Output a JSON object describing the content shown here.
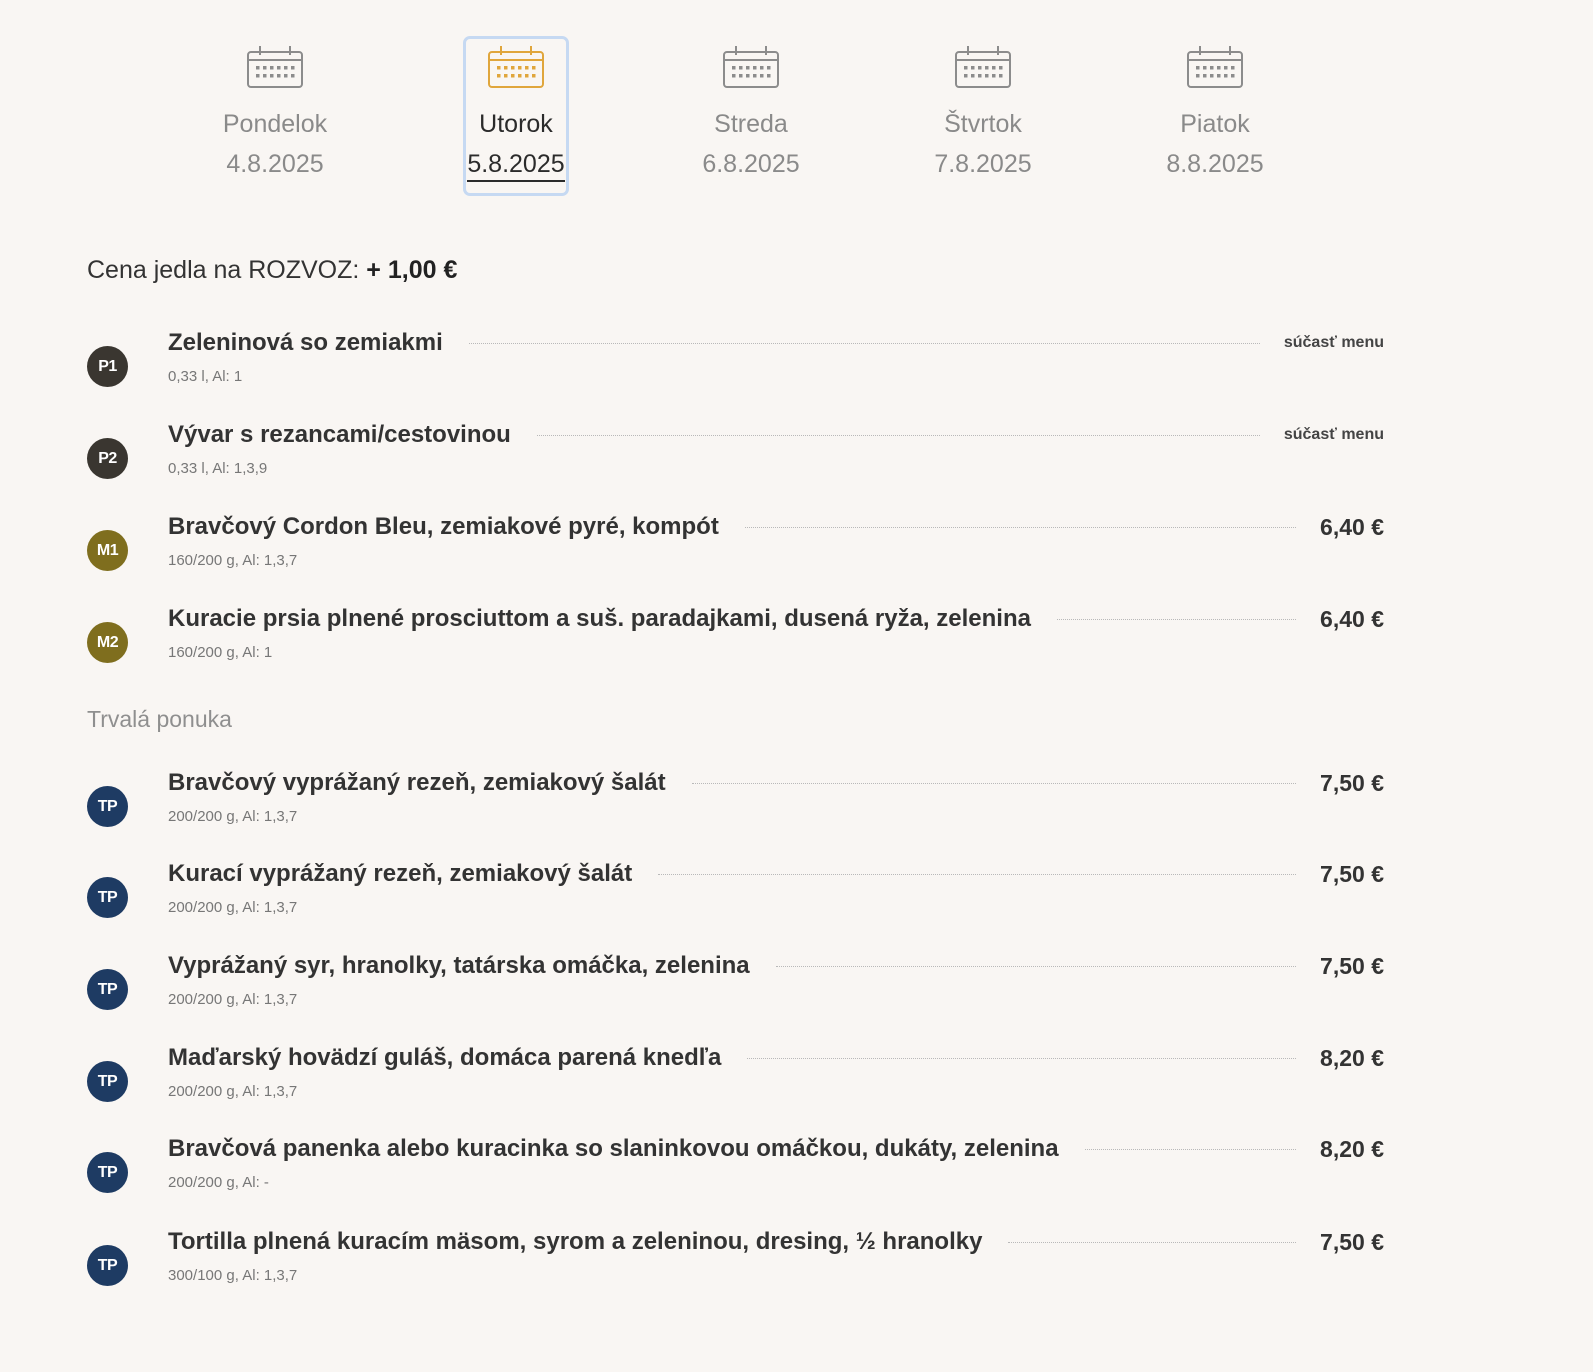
{
  "days": [
    {
      "name": "Pondelok",
      "date": "4.8.2025",
      "icon": "calendar-icon",
      "active": false
    },
    {
      "name": "Utorok",
      "date": "5.8.2025",
      "icon": "calendar-icon",
      "active": true
    },
    {
      "name": "Streda",
      "date": "6.8.2025",
      "icon": "calendar-icon",
      "active": false
    },
    {
      "name": "Štvrtok",
      "date": "7.8.2025",
      "icon": "calendar-icon",
      "active": false
    },
    {
      "name": "Piatok",
      "date": "8.8.2025",
      "icon": "calendar-icon",
      "active": false
    }
  ],
  "delivery": {
    "label": "Cena jedla na ROZVOZ:",
    "value": "+ 1,00  €"
  },
  "daily_menu": [
    {
      "code": "P1",
      "name": "Zeleninová so zemiakmi",
      "meta": "0,33 l, Al: 1",
      "price": "súčasť menu"
    },
    {
      "code": "P2",
      "name": "Vývar s rezancami/cestovinou",
      "meta": "0,33 l, Al: 1,3,9",
      "price": "súčasť menu"
    },
    {
      "code": "M1",
      "name": "Bravčový Cordon Bleu, zemiakové pyré, kompót",
      "meta": "160/200 g, Al: 1,3,7",
      "price": "6,40 €"
    },
    {
      "code": "M2",
      "name": "Kuracie prsia plnené prosciuttom a suš. paradajkami, dusená ryža, zelenina",
      "meta": "160/200 g, Al: 1",
      "price": "6,40 €"
    }
  ],
  "permanent_title": "Trvalá ponuka",
  "permanent_menu": [
    {
      "code": "TP",
      "name": "Bravčový vyprážaný rezeň, zemiakový šalát",
      "meta": "200/200 g, Al: 1,3,7",
      "price": "7,50 €"
    },
    {
      "code": "TP",
      "name": "Kurací vyprážaný rezeň, zemiakový šalát",
      "meta": "200/200 g, Al: 1,3,7",
      "price": "7,50 €"
    },
    {
      "code": "TP",
      "name": "Vyprážaný syr, hranolky, tatárska omáčka, zelenina",
      "meta": "200/200 g, Al: 1,3,7",
      "price": "7,50 €"
    },
    {
      "code": "TP",
      "name": "Maďarský hovädzí guláš, domáca parená knedľa",
      "meta": "200/200 g, Al: 1,3,7",
      "price": "8,20 €"
    },
    {
      "code": "TP",
      "name": "Bravčová panenka alebo kuracinka so slaninkovou omáčkou, dukáty, zelenina",
      "meta": "200/200 g, Al: -",
      "price": "8,20 €"
    },
    {
      "code": "TP",
      "name": "Tortilla plnená kuracím mäsom, syrom a zeleninou, dresing, ½ hranolky",
      "meta": "300/100 g, Al: 1,3,7",
      "price": "7,50 €"
    }
  ],
  "colors": {
    "background": "#f9f6f3",
    "active_icon": "#e0a63c",
    "inactive_icon": "#8c8c8c",
    "active_border": "#c6d9f2",
    "badge_soup": "#3a3630",
    "badge_main": "#7f6e1e",
    "badge_permanent": "#1e3b63"
  }
}
